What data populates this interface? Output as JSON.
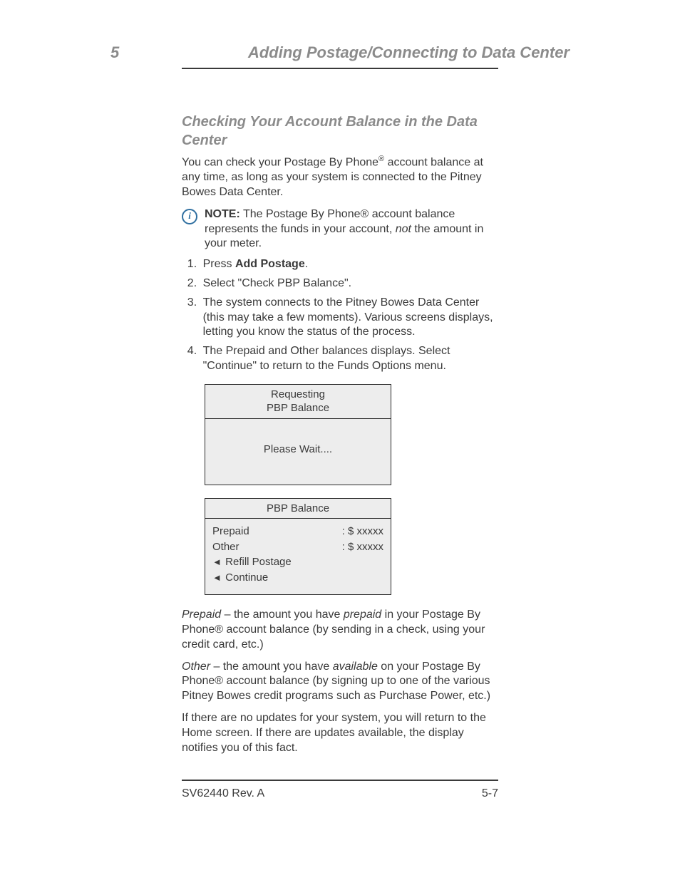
{
  "header": {
    "chapter_num": "5",
    "chapter_title": "Adding Postage/Connecting to Data Center"
  },
  "section_heading": "Checking Your Account Balance in the Data Center",
  "intro": {
    "part1": "You can check your Postage By Phone",
    "reg": "®",
    "part2": " account balance at any time, as long as your system is connected to the Pitney Bowes Data Center."
  },
  "note": {
    "label": "NOTE:",
    "text1": " The Postage By Phone® account balance represents the funds in your account, ",
    "ital": "not",
    "text2": " the amount in your meter."
  },
  "steps": {
    "s1a": "Press ",
    "s1b": "Add Postage",
    "s1c": ".",
    "s2": "Select \"Check PBP Balance\".",
    "s3": "The system connects to the Pitney Bowes Data Center (this may take a few moments). Various screens displays, letting you know the status of the process.",
    "s4": "The Prepaid and Other balances displays. Select \"Continue\" to return to the Funds Options menu."
  },
  "screen1": {
    "header_line1": "Requesting",
    "header_line2": "PBP Balance",
    "body": "Please Wait...."
  },
  "screen2": {
    "header": "PBP Balance",
    "row1_label": "Prepaid",
    "row1_value": ":  $ xxxxx",
    "row2_label": "Other",
    "row2_value": ":  $ xxxxx",
    "item1": " Refill Postage",
    "item2": " Continue"
  },
  "defs": {
    "d1_label": "Prepaid",
    "d1_a": " – the amount you have ",
    "d1_ital": "prepaid",
    "d1_b": " in your Postage By Phone® account balance (by sending in a check, using your credit card, etc.)",
    "d2_label": "Other",
    "d2_a": " – the amount you have ",
    "d2_ital": "available",
    "d2_b": " on your Postage By Phone® account balance (by signing up to one of the various Pitney Bowes credit programs such as Purchase Power, etc.)"
  },
  "closing": "If there are no updates for your system, you will return to the Home screen. If there are updates available, the display notifies you of this fact.",
  "footer": {
    "product": "SV62440 Rev. A",
    "page": "5-7"
  }
}
